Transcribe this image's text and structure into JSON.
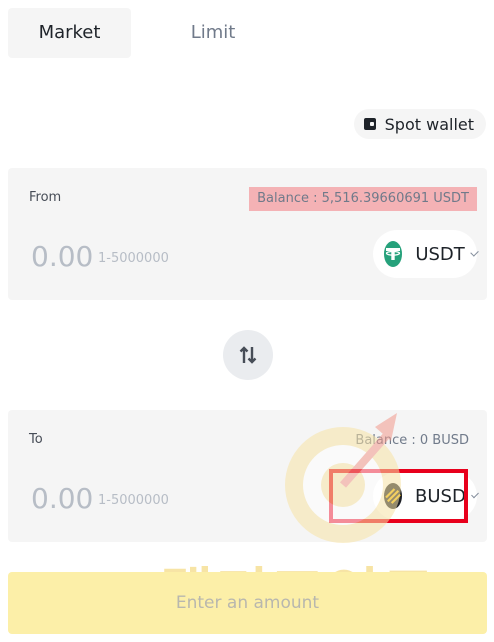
{
  "tabs": {
    "market": "Market",
    "limit": "Limit"
  },
  "spot_wallet": {
    "label": "Spot wallet",
    "icon": "wallet-icon"
  },
  "from": {
    "label": "From",
    "balance": "Balance : 5,516.39660691 USDT",
    "amount_placeholder": "0.00",
    "range": "1-5000000",
    "token": "USDT",
    "token_icon": "usdt-icon",
    "token_color": "#26a17b"
  },
  "swap": {
    "icon": "swap-arrows-icon"
  },
  "to": {
    "label": "To",
    "balance": "Balance : 0 BUSD",
    "amount_placeholder": "0.00",
    "range": "1-5000000",
    "token": "BUSD",
    "token_icon": "busd-icon",
    "token_color": "#f0b90b"
  },
  "cta": {
    "label": "Enter an amount"
  },
  "watermark": {
    "text": "랠리포인트"
  },
  "colors": {
    "accent": "#f0b90b",
    "highlight": "#f4b2b5",
    "annotation": "#e8001c",
    "panel": "#f5f5f5"
  }
}
